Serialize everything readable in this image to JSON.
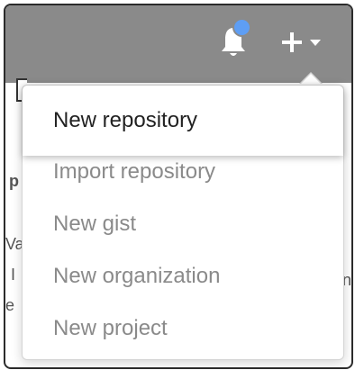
{
  "menu": {
    "items": [
      {
        "label": "New repository"
      },
      {
        "label": "Import repository"
      },
      {
        "label": "New gist"
      },
      {
        "label": "New organization"
      },
      {
        "label": "New project"
      }
    ]
  },
  "icons": {
    "bell": "bell-icon",
    "plus": "plus-icon",
    "caret": "caret-down-icon"
  },
  "colors": {
    "header": "#8a8a8a",
    "notification_dot": "#5e9ef4",
    "menu_text": "#8a8a8a",
    "menu_text_active": "#222222"
  },
  "background": {
    "fragment_p": "p",
    "fragment_wa": "Va",
    "fragment_i": "I",
    "fragment_e": "e",
    "fragment_ne": "ne"
  }
}
